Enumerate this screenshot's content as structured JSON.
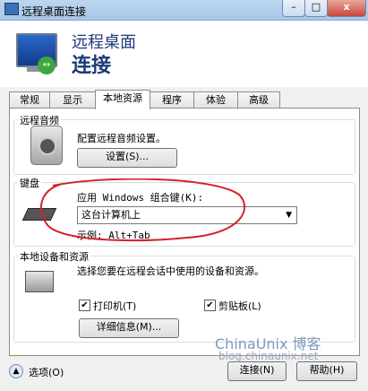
{
  "window": {
    "title": "远程桌面连接",
    "minimize": "–",
    "maximize": "□",
    "close": "x"
  },
  "header": {
    "line1": "远程桌面",
    "line2": "连接"
  },
  "tabs": [
    {
      "label": "常规"
    },
    {
      "label": "显示"
    },
    {
      "label": "本地资源"
    },
    {
      "label": "程序"
    },
    {
      "label": "体验"
    },
    {
      "label": "高级"
    }
  ],
  "audio": {
    "legend": "远程音频",
    "description": "配置远程音频设置。",
    "settings_button": "设置(S)..."
  },
  "keyboard": {
    "legend": "键盘",
    "label": "应用 Windows 组合键(K):",
    "selected": "这台计算机上",
    "example": "示例: Alt+Tab"
  },
  "devices": {
    "legend": "本地设备和资源",
    "description": "选择您要在远程会话中使用的设备和资源。",
    "printer": "打印机(T)",
    "clipboard": "剪贴板(L)",
    "details_button": "详细信息(M)..."
  },
  "footer": {
    "options": "选项(O)",
    "connect": "连接(N)",
    "help": "帮助(H)"
  },
  "watermark": {
    "main": "ChinaUnix 博客",
    "sub": "blog.chinaunix.net"
  },
  "colors": {
    "annotation": "#d8202a",
    "header_text": "#1e3a78"
  }
}
